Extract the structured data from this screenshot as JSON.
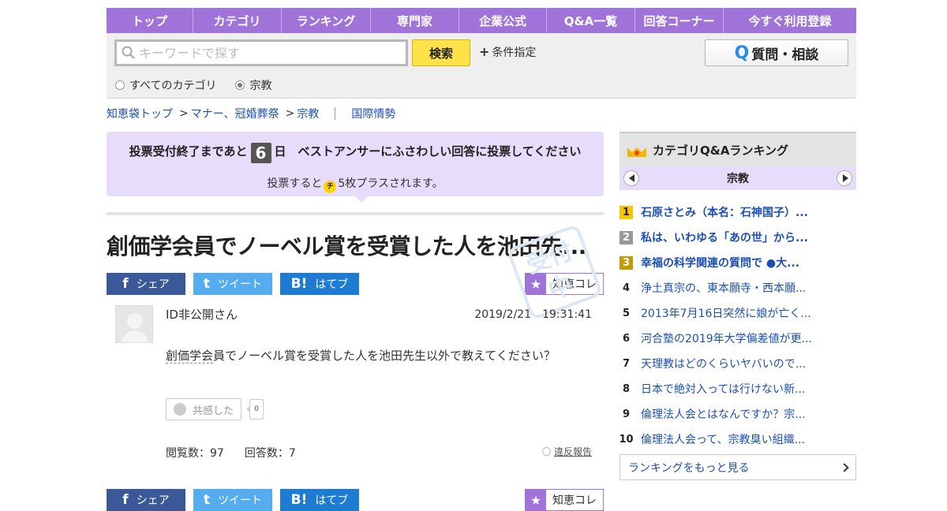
{
  "nav": [
    {
      "label": "トップ",
      "w": 110
    },
    {
      "label": "カテゴリ",
      "w": 112
    },
    {
      "label": "ランキング",
      "w": 113
    },
    {
      "label": "専門家",
      "w": 112
    },
    {
      "label": "企業公式",
      "w": 111
    },
    {
      "label": "Q&A一覧",
      "w": 112
    },
    {
      "label": "回答コーナー",
      "w": 112
    },
    {
      "label": "今すぐ利用登録",
      "w": 152
    }
  ],
  "search": {
    "placeholder": "キーワードで探す",
    "button": "検索",
    "condition": "条件指定",
    "ask_button": "質問・相談",
    "radio_all": "すべてのカテゴリ",
    "radio_current": "宗教"
  },
  "breadcrumb": {
    "top": "知恵袋トップ",
    "l1": "マナー、冠婚葬祭",
    "l2": "宗教",
    "related": "国際情勢",
    "sep": ">"
  },
  "vote": {
    "prefix": "投票受付終了まであと",
    "days": "6",
    "suffix": "日　ベストアンサーにふさわしい回答に投票してください",
    "line2_a": "投票すると",
    "coin": "チ",
    "line2_b": "5枚プラスされます。"
  },
  "question": {
    "title": "創価学会員でノーベル賞を受賞した人を池田先...",
    "user": "ID非公開さん",
    "date": "2019/2/21　19:31:41",
    "body_u": "創価学会",
    "body_rest": "員でノーベル賞を受賞した人を池田先生以外で教えてください？",
    "empathy_label": "共感した",
    "empathy_count": "0",
    "views": "閲覧数：97",
    "answers": "回答数：7",
    "report": "違反報告",
    "stamp": "受付中"
  },
  "share": {
    "fb_icon": "f",
    "fb": "シェア",
    "tw_icon": "t",
    "tw": "ツイート",
    "hb_icon": "B!",
    "hb": "はてブ",
    "chie": "知恵コレ"
  },
  "ranking": {
    "title": "カテゴリQ&Aランキング",
    "category": "宗教",
    "items": [
      {
        "rank": "1",
        "title": "石原さとみ（本名：石神国子）...",
        "bold": true
      },
      {
        "rank": "2",
        "title": "私は、いわゆる「あの世」から...",
        "bold": true
      },
      {
        "rank": "3",
        "title": "幸福の科学関連の質問で ●大...",
        "bold": true
      },
      {
        "rank": "4",
        "title": "浄土真宗の、東本願寺・西本願...",
        "bold": false
      },
      {
        "rank": "5",
        "title": "2013年7月16日突然に娘が亡く...",
        "bold": false
      },
      {
        "rank": "6",
        "title": "河合塾の2019年大学偏差値が更...",
        "bold": false
      },
      {
        "rank": "7",
        "title": "天理教はどのくらいヤバいので...",
        "bold": false
      },
      {
        "rank": "8",
        "title": "日本で絶対入っては行けない新...",
        "bold": false
      },
      {
        "rank": "9",
        "title": "倫理法人会とはなんですか？宗...",
        "bold": false
      },
      {
        "rank": "10",
        "title": "倫理法人会って、宗教臭い組織...",
        "bold": false
      }
    ],
    "more": "ランキングをもっと見る"
  }
}
